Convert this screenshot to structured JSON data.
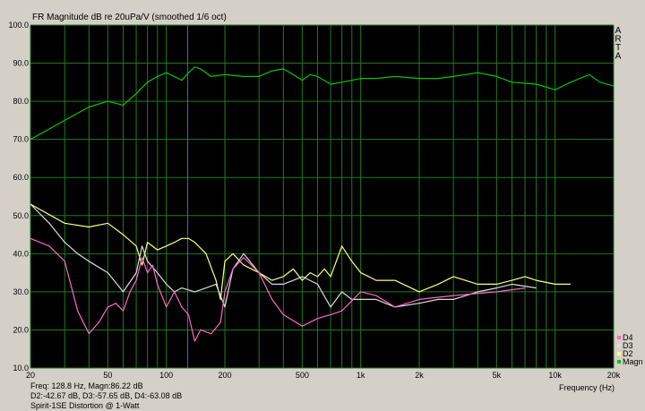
{
  "chart_data": {
    "type": "line",
    "title": "FR Magnitude dB re 20uPa/V (smoothed 1/6 oct)",
    "xlabel": "Frequency (Hz)",
    "ylabel": "",
    "x_scale": "log",
    "xlim": [
      20,
      20000
    ],
    "ylim": [
      10,
      100
    ],
    "y_ticks": [
      "10.0",
      "20.0",
      "30.0",
      "40.0",
      "50.0",
      "60.0",
      "70.0",
      "80.0",
      "90.0",
      "100.0"
    ],
    "x_ticks": [
      {
        "v": 20,
        "l": "20"
      },
      {
        "v": 50,
        "l": "50"
      },
      {
        "v": 100,
        "l": "100"
      },
      {
        "v": 200,
        "l": "200"
      },
      {
        "v": 500,
        "l": "500"
      },
      {
        "v": 1000,
        "l": "1k"
      },
      {
        "v": 2000,
        "l": "2k"
      },
      {
        "v": 5000,
        "l": "5k"
      },
      {
        "v": 10000,
        "l": "10k"
      },
      {
        "v": 20000,
        "l": "20k"
      }
    ],
    "grid": true,
    "legend_position": "bottom-right",
    "series": [
      {
        "name": "Magn",
        "color": "#00c800",
        "x": [
          20,
          30,
          40,
          50,
          60,
          70,
          80,
          90,
          100,
          110,
          120,
          130,
          140,
          150,
          170,
          200,
          250,
          300,
          350,
          400,
          450,
          500,
          550,
          600,
          700,
          800,
          900,
          1000,
          1200,
          1500,
          2000,
          2500,
          3000,
          4000,
          5000,
          6000,
          8000,
          10000,
          12000,
          15000,
          17000,
          20000
        ],
        "y": [
          70,
          75,
          78.5,
          80,
          79,
          82,
          85,
          86.5,
          87.5,
          86.5,
          85.5,
          87.5,
          89,
          88.5,
          86.5,
          87,
          86.5,
          86.5,
          88,
          88.5,
          87,
          85.5,
          87,
          86.5,
          84.5,
          85,
          85.5,
          86,
          86,
          86.5,
          86,
          86,
          86.5,
          87.5,
          86.5,
          85,
          84.5,
          83,
          85,
          87,
          85,
          84
        ]
      },
      {
        "name": "D2",
        "color": "#ffff80",
        "x": [
          20,
          30,
          40,
          50,
          60,
          70,
          75,
          80,
          90,
          100,
          110,
          120,
          130,
          140,
          160,
          180,
          190,
          200,
          220,
          250,
          300,
          350,
          400,
          450,
          500,
          550,
          600,
          650,
          700,
          800,
          900,
          1000,
          1100,
          1200,
          1500,
          2000,
          2500,
          3000,
          4000,
          5000,
          6000,
          7000,
          8000,
          10000,
          12000
        ],
        "y": [
          53,
          48,
          47,
          48,
          45,
          42,
          37,
          43,
          41,
          42,
          43,
          44,
          44,
          43,
          40,
          33,
          28,
          38,
          40,
          37,
          35,
          33,
          34,
          36,
          33,
          35,
          34,
          36,
          34,
          42,
          38,
          35,
          34,
          33,
          33,
          30,
          32,
          34,
          32,
          32,
          33,
          34,
          33,
          32,
          32
        ]
      },
      {
        "name": "D3",
        "color": "#dcdcdc",
        "x": [
          20,
          25,
          30,
          35,
          40,
          50,
          60,
          70,
          75,
          80,
          90,
          100,
          110,
          120,
          140,
          160,
          180,
          200,
          220,
          250,
          300,
          350,
          400,
          450,
          500,
          600,
          700,
          800,
          900,
          1000,
          1200,
          1500,
          2000,
          2500,
          3000,
          4000,
          5000,
          6000,
          8000
        ],
        "y": [
          53,
          48,
          43,
          40,
          38,
          35,
          30,
          35,
          42,
          38,
          35,
          32,
          30,
          31,
          30,
          31,
          32,
          26,
          36,
          40,
          35,
          32,
          32,
          33,
          34,
          32,
          26,
          30,
          28,
          28,
          28,
          26,
          27,
          28,
          28,
          30,
          31,
          32,
          31
        ]
      },
      {
        "name": "D4",
        "color": "#ff66cc",
        "x": [
          20,
          25,
          30,
          35,
          40,
          45,
          50,
          55,
          60,
          65,
          70,
          75,
          80,
          85,
          90,
          100,
          110,
          120,
          130,
          140,
          150,
          170,
          190,
          200,
          220,
          250,
          300,
          350,
          400,
          500,
          600,
          700,
          800,
          1000,
          1200,
          1500,
          2000,
          3000,
          5000,
          7000
        ],
        "y": [
          44,
          42,
          38,
          25,
          19,
          22,
          26,
          27,
          25,
          30,
          33,
          39,
          35,
          37,
          32,
          26,
          30,
          26,
          24,
          17,
          20,
          19,
          22,
          30,
          36,
          39,
          35,
          28,
          24,
          21,
          23,
          24,
          25,
          30,
          29,
          26,
          28,
          29,
          30,
          31
        ]
      }
    ]
  },
  "info": {
    "line1": "Freq: 128.8 Hz, Magn:86.22 dB",
    "line2": "D2:-42.67 dB, D3:-57.65 dB, D4:-63.08 dB",
    "line3": "Spirit-1SE Distortion @ 1-Watt"
  },
  "brand_letters": [
    "A",
    "R",
    "T",
    "A"
  ],
  "cursor_freq": 128.8
}
